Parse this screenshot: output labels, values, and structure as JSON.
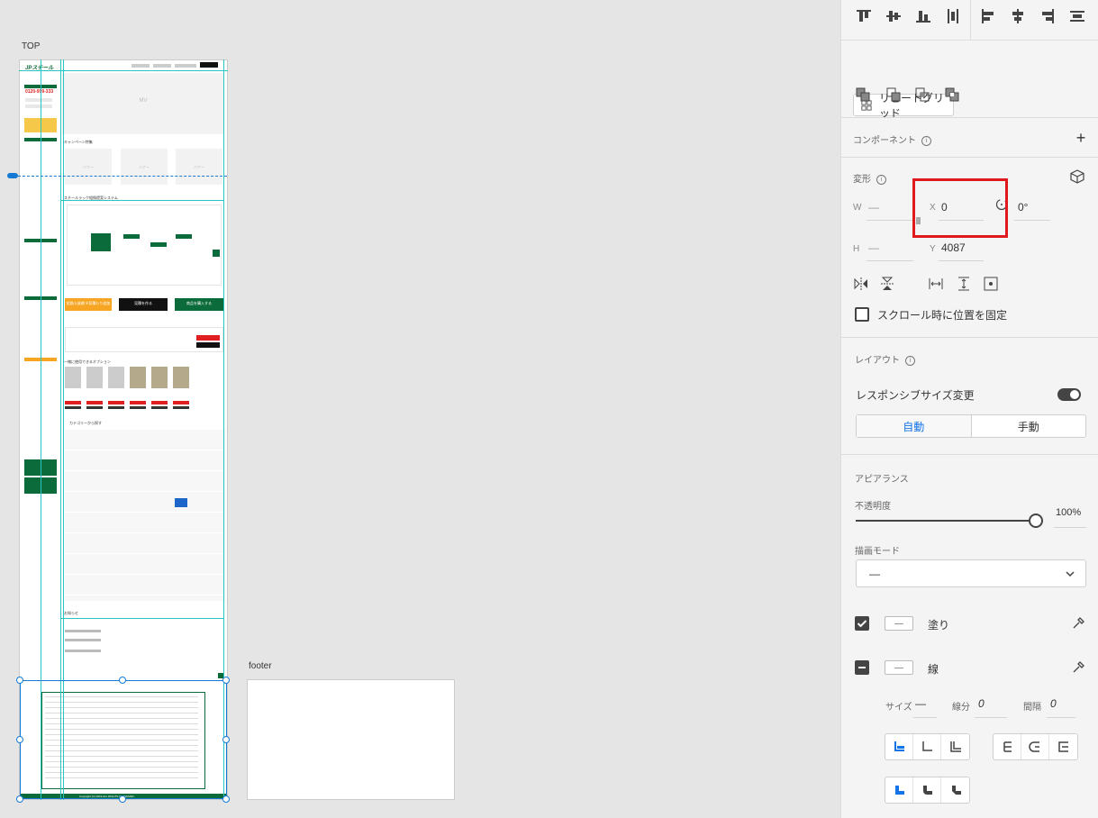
{
  "canvas": {
    "artboards": [
      {
        "name": "TOP"
      },
      {
        "name": "footer"
      }
    ],
    "mock": {
      "mv_label": "MV",
      "banner_labels": [
        "バナー",
        "バナー",
        "バナー"
      ],
      "campaign_title": "キャンペーン特集",
      "system_title": "スチールラック組換提案システム",
      "buttons": [
        "組換え候補 ※見積もり追加",
        "見積を作る",
        "商品を購入する"
      ],
      "options_title": "一緒に使用できるオプション",
      "category_title": "カテゴリーから探す",
      "news_title": "お知らせ",
      "copyright": "Copyright (C) 2019 ALL RIGHTS RESERVED."
    }
  },
  "inspector": {
    "repeat_grid_label": "リピートグリッド",
    "component_title": "コンポーネント",
    "transform_title": "変形",
    "w_label": "W",
    "w_value": "—",
    "x_label": "X",
    "x_value": "0",
    "rotation_value": "0°",
    "h_label": "H",
    "h_value": "—",
    "y_label": "Y",
    "y_value": "4087",
    "fix_scroll_label": "スクロール時に位置を固定",
    "layout_title": "レイアウト",
    "responsive_label": "レスポンシブサイズ変更",
    "responsive_enabled": true,
    "seg_auto": "自動",
    "seg_manual": "手動",
    "appearance_title": "アピアランス",
    "opacity_label": "不透明度",
    "opacity_value": "100%",
    "blend_title": "描画モード",
    "blend_value": "—",
    "fill_label": "塗り",
    "fill_checked": true,
    "stroke_label": "線",
    "size_label": "サイズ",
    "size_value": "—",
    "dash_label": "線分",
    "dash_value": "0",
    "gap_label": "間隔",
    "gap_value": "0",
    "accent": "#1473e6",
    "highlight_color": "#e0191f",
    "brand_green": "#0b6b3a"
  }
}
